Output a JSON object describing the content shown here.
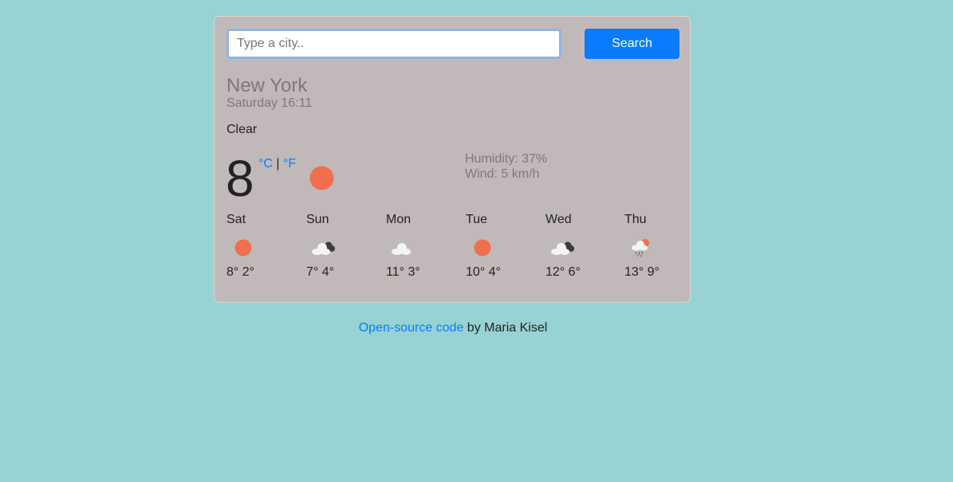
{
  "search": {
    "placeholder": "Type a city..",
    "button_label": "Search"
  },
  "current": {
    "city": "New York",
    "date": "Saturday 16:11",
    "description": "Clear",
    "temperature": "8",
    "unit_celsius": "°C",
    "unit_separator": "|",
    "unit_fahrenheit": "°F",
    "humidity": "Humidity: 37%",
    "wind": "Wind: 5 km/h",
    "icon": "sun-icon"
  },
  "forecast": [
    {
      "day": "Sat",
      "temps": "8° 2°",
      "icon": "sun-icon"
    },
    {
      "day": "Sun",
      "temps": "7° 4°",
      "icon": "broken-clouds-icon"
    },
    {
      "day": "Mon",
      "temps": "11° 3°",
      "icon": "cloud-icon"
    },
    {
      "day": "Tue",
      "temps": "10° 4°",
      "icon": "sun-icon"
    },
    {
      "day": "Wed",
      "temps": "12° 6°",
      "icon": "broken-clouds-icon"
    },
    {
      "day": "Thu",
      "temps": "13° 9°",
      "icon": "rain-sun-icon"
    }
  ],
  "footer": {
    "link_text": "Open-source code",
    "suffix": " by Maria Kisel"
  },
  "colors": {
    "background": "#96d3d2",
    "card": "#c1b9b9",
    "accent": "#0a7bfd",
    "sun": "#ef6f4e"
  }
}
